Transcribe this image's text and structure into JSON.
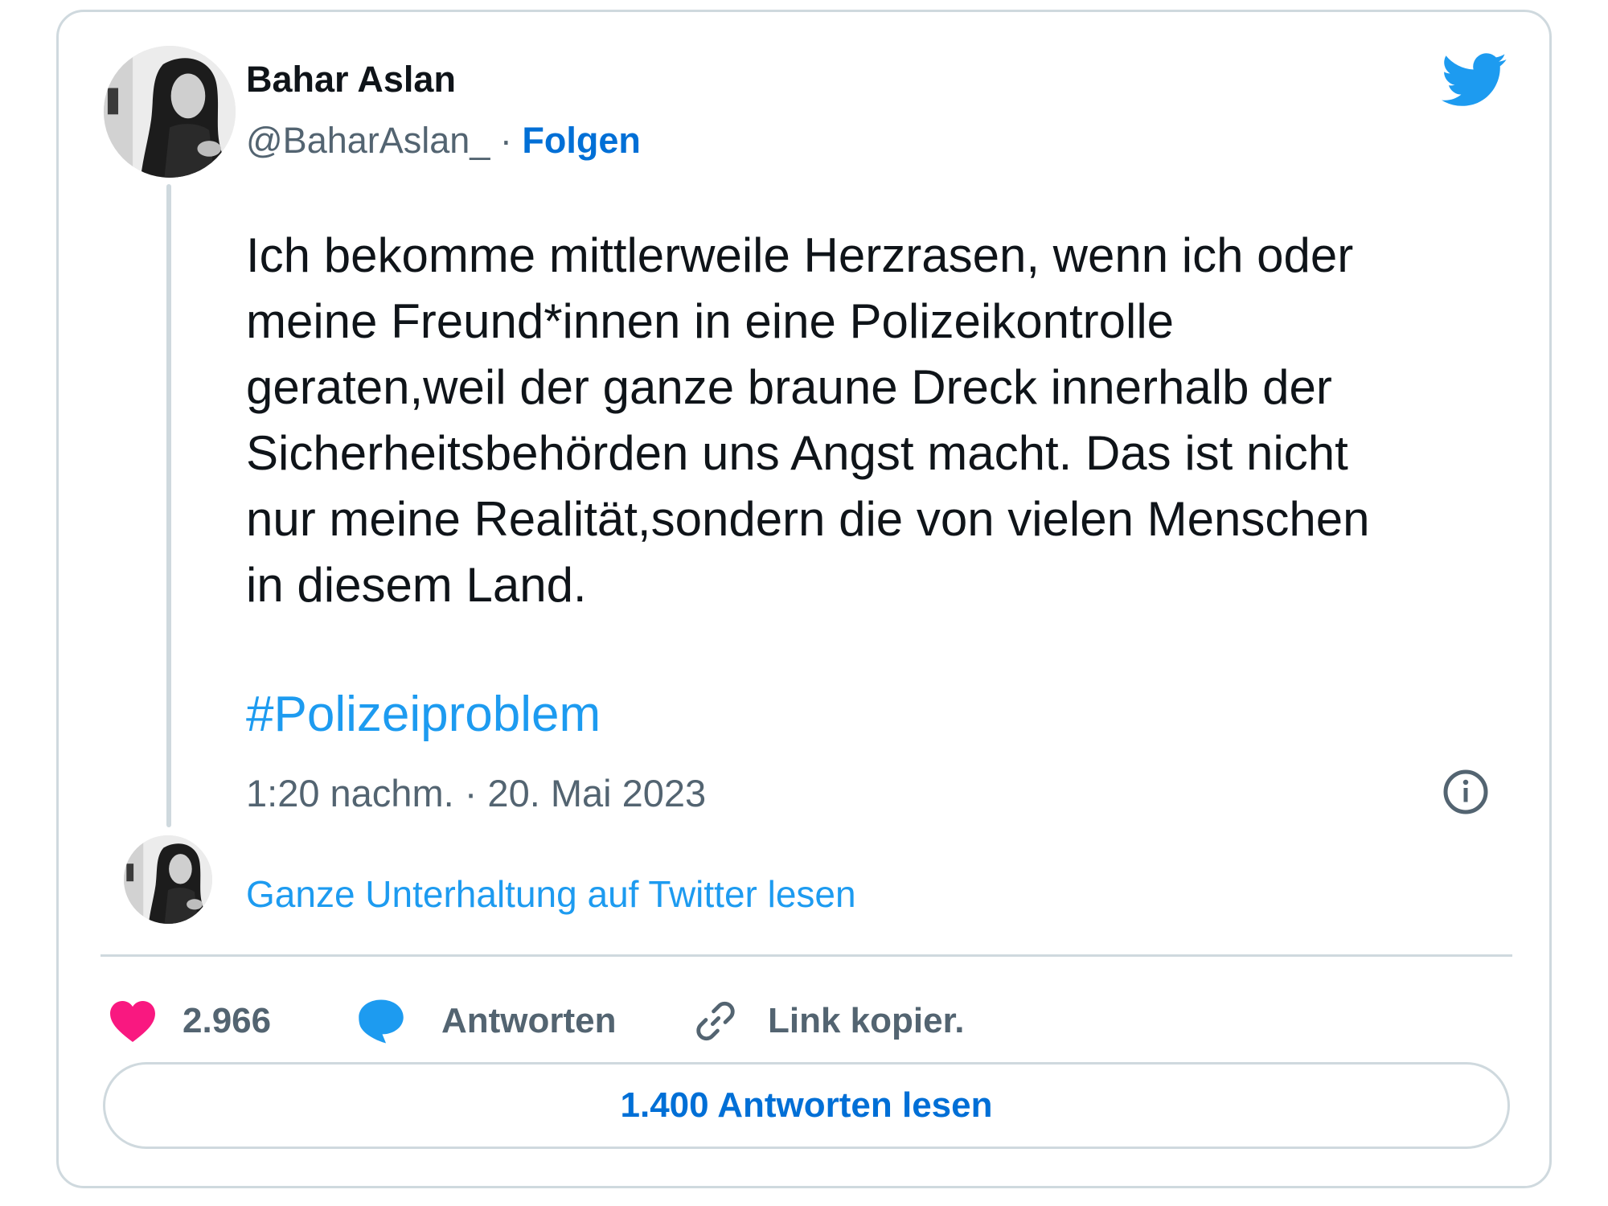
{
  "author": {
    "name": "Bahar Aslan",
    "handle": "@BaharAslan_",
    "separator": " · ",
    "follow_label": "Folgen"
  },
  "tweet": {
    "text": "Ich bekomme mittlerweile Herzrasen, wenn ich oder\nmeine Freund*innen in eine Polizeikontrolle\ngeraten,weil der ganze braune Dreck innerhalb der\nSicherheitsbehörden uns Angst macht. Das ist nicht\nnur meine Realität,sondern die von vielen Menschen\nin diesem Land.",
    "hashtag": "#Polizeiproblem",
    "timestamp": "1:20 nachm. · 20. Mai 2023"
  },
  "conversation_link": "Ganze Unterhaltung auf Twitter lesen",
  "actions": {
    "like_count": "2.966",
    "reply_label": "Antworten",
    "copy_link_label": "Link kopier."
  },
  "read_replies_label": "1.400 Antworten lesen",
  "icons": {
    "brand": "twitter-bird-icon",
    "info": "info-icon",
    "like": "heart-icon",
    "reply": "speech-bubble-icon",
    "copy": "link-icon"
  },
  "colors": {
    "link_blue": "#006fd6",
    "hashtag_blue": "#1d9bf0",
    "like_pink": "#f91880",
    "secondary_text": "#536471",
    "border": "#cfd9de"
  }
}
